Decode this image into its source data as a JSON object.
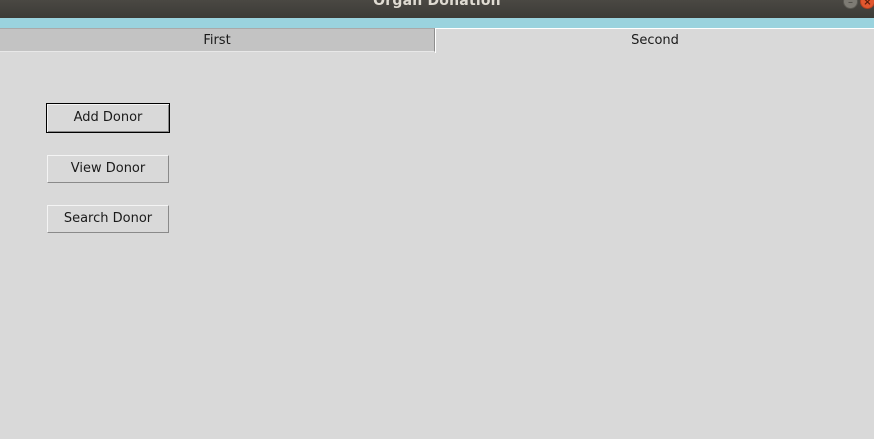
{
  "window": {
    "title": "Organ Donation",
    "minimize_glyph": "–",
    "close_glyph": "×"
  },
  "tabs": [
    {
      "label": "First",
      "selected": false
    },
    {
      "label": "Second",
      "selected": true
    }
  ],
  "buttons": {
    "add_donor": "Add Donor",
    "view_donor": "View Donor",
    "search_donor": "Search Donor"
  },
  "colors": {
    "title_bar": "#3c3b37",
    "accent_strip": "#9ad3de",
    "background": "#d9d9d9",
    "close_button": "#e2572f"
  }
}
